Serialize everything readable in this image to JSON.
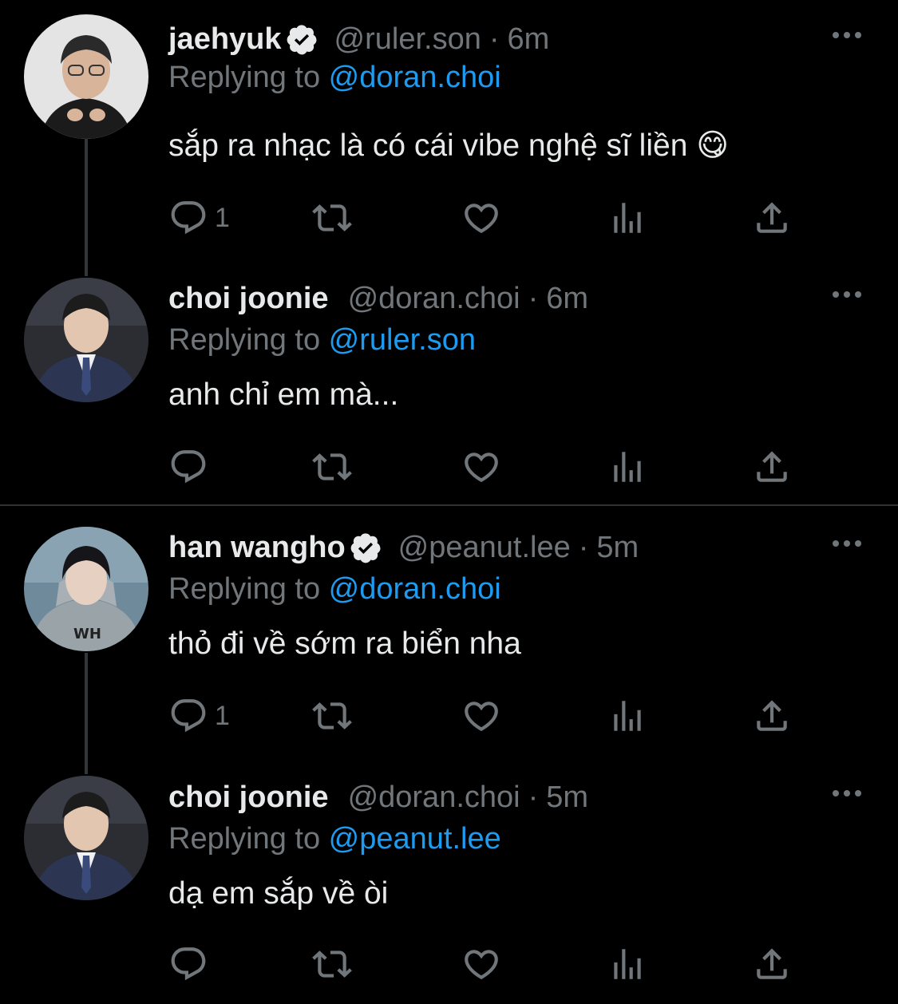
{
  "tweets": [
    {
      "name": "jaehyuk",
      "verified": true,
      "handle": "@ruler.son",
      "sep": "·",
      "time": "6m",
      "replying_prefix": "Replying to ",
      "replying_to": "@doran.choi",
      "text": "sắp ra nhạc là có cái vibe nghệ sĩ liền 😋",
      "reply_count": "1"
    },
    {
      "name": "choi joonie",
      "verified": false,
      "handle": "@doran.choi",
      "sep": "·",
      "time": "6m",
      "replying_prefix": "Replying to ",
      "replying_to": "@ruler.son",
      "text": "anh chỉ em mà...",
      "reply_count": ""
    },
    {
      "name": "han wangho",
      "verified": true,
      "handle": "@peanut.lee",
      "sep": "·",
      "time": "5m",
      "replying_prefix": "Replying to ",
      "replying_to": "@doran.choi",
      "text": "thỏ đi về sớm ra biển nha",
      "reply_count": "1"
    },
    {
      "name": "choi joonie",
      "verified": false,
      "handle": "@doran.choi",
      "sep": "·",
      "time": "5m",
      "replying_prefix": "Replying to ",
      "replying_to": "@peanut.lee",
      "text": "dạ em sắp về òi",
      "reply_count": ""
    }
  ],
  "icons": {
    "reply": "reply-icon",
    "retweet": "retweet-icon",
    "like": "heart-icon",
    "views": "analytics-icon",
    "share": "share-icon",
    "more": "more-icon",
    "verified": "verified-badge-icon"
  },
  "colors": {
    "background": "#000000",
    "text": "#e7e9ea",
    "muted": "#71767b",
    "accent": "#1d9bf0"
  }
}
